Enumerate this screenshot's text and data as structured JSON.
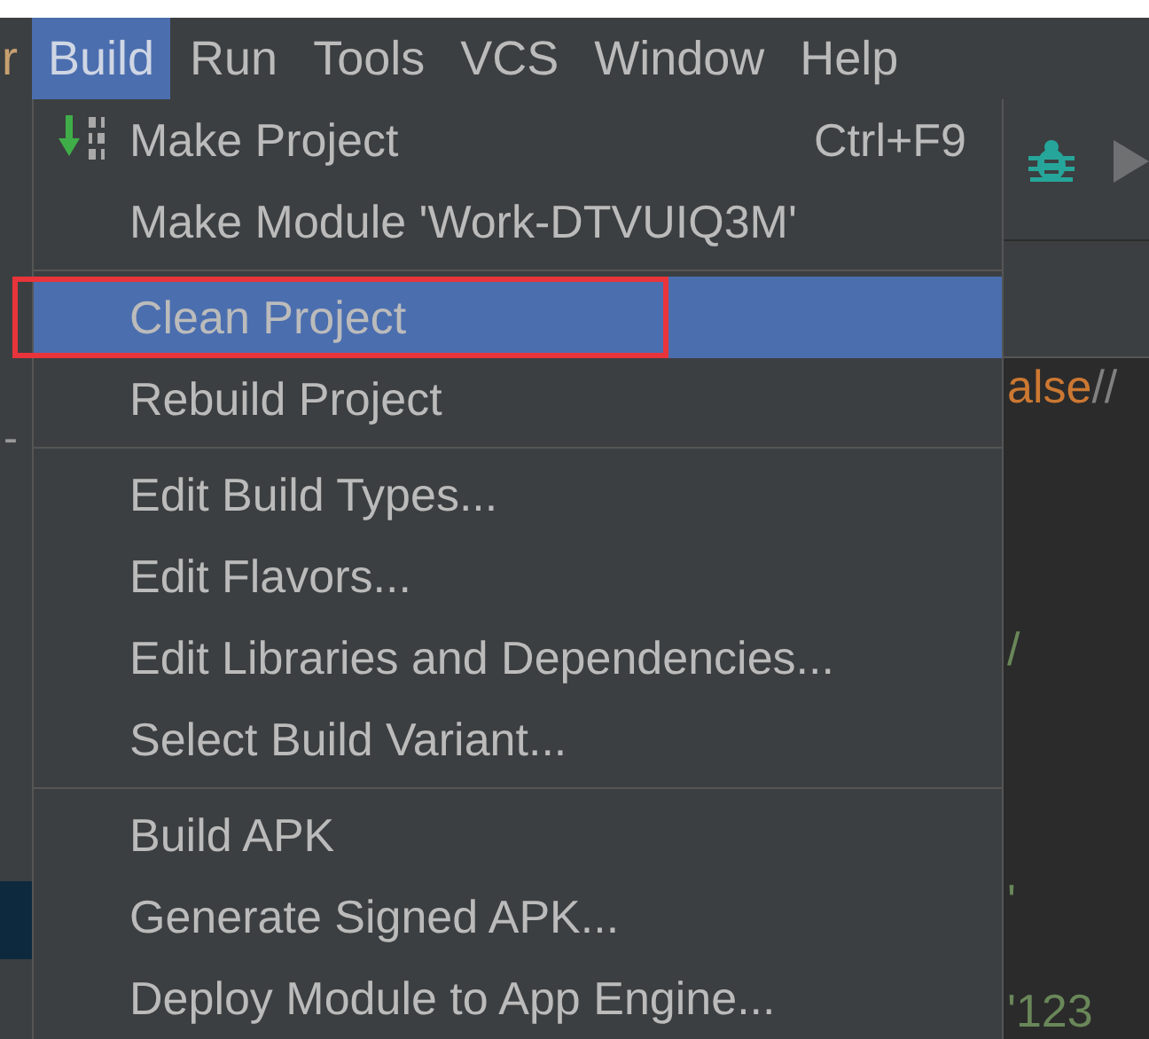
{
  "menu_bar": [
    {
      "label": "r",
      "selected": false
    },
    {
      "label": "Build",
      "selected": true
    },
    {
      "label": "Run",
      "selected": false
    },
    {
      "label": "Tools",
      "selected": false
    },
    {
      "label": "VCS",
      "selected": false
    },
    {
      "label": "Window",
      "selected": false
    },
    {
      "label": "Help",
      "selected": false
    }
  ],
  "build_menu": [
    {
      "kind": "item",
      "label": "Make Project",
      "shortcut": "Ctrl+F9",
      "selected": false,
      "annotated": false
    },
    {
      "kind": "item",
      "label": "Make Module 'Work-DTVUIQ3M'",
      "selected": false,
      "annotated": false
    },
    {
      "kind": "separator"
    },
    {
      "kind": "item",
      "label": "Clean Project",
      "selected": true,
      "annotated": true
    },
    {
      "kind": "item",
      "label": "Rebuild Project",
      "selected": false,
      "annotated": false
    },
    {
      "kind": "separator"
    },
    {
      "kind": "item",
      "label": "Edit Build Types...",
      "selected": false,
      "annotated": false
    },
    {
      "kind": "item",
      "label": "Edit Flavors...",
      "selected": false,
      "annotated": false
    },
    {
      "kind": "item",
      "label": "Edit Libraries and Dependencies...",
      "selected": false,
      "annotated": false
    },
    {
      "kind": "item",
      "label": "Select Build Variant...",
      "selected": false,
      "annotated": false
    },
    {
      "kind": "separator"
    },
    {
      "kind": "item",
      "label": "Build APK",
      "selected": false,
      "annotated": false
    },
    {
      "kind": "item",
      "label": "Generate Signed APK...",
      "selected": false,
      "annotated": false
    },
    {
      "kind": "item",
      "label": "Deploy Module to App Engine...",
      "selected": false,
      "annotated": false
    }
  ],
  "left_panel": {
    "text": "-"
  },
  "editor_fragments": [
    {
      "parts": [
        {
          "kind": "keyword",
          "text": "alse"
        },
        {
          "kind": "comment",
          "text": "//"
        }
      ]
    },
    {
      "parts": [
        {
          "kind": "string",
          "text": "/"
        }
      ]
    },
    {
      "parts": [
        {
          "kind": "string",
          "text": "'"
        }
      ]
    },
    {
      "parts": [
        {
          "kind": "string",
          "text": "'123"
        }
      ]
    }
  ]
}
